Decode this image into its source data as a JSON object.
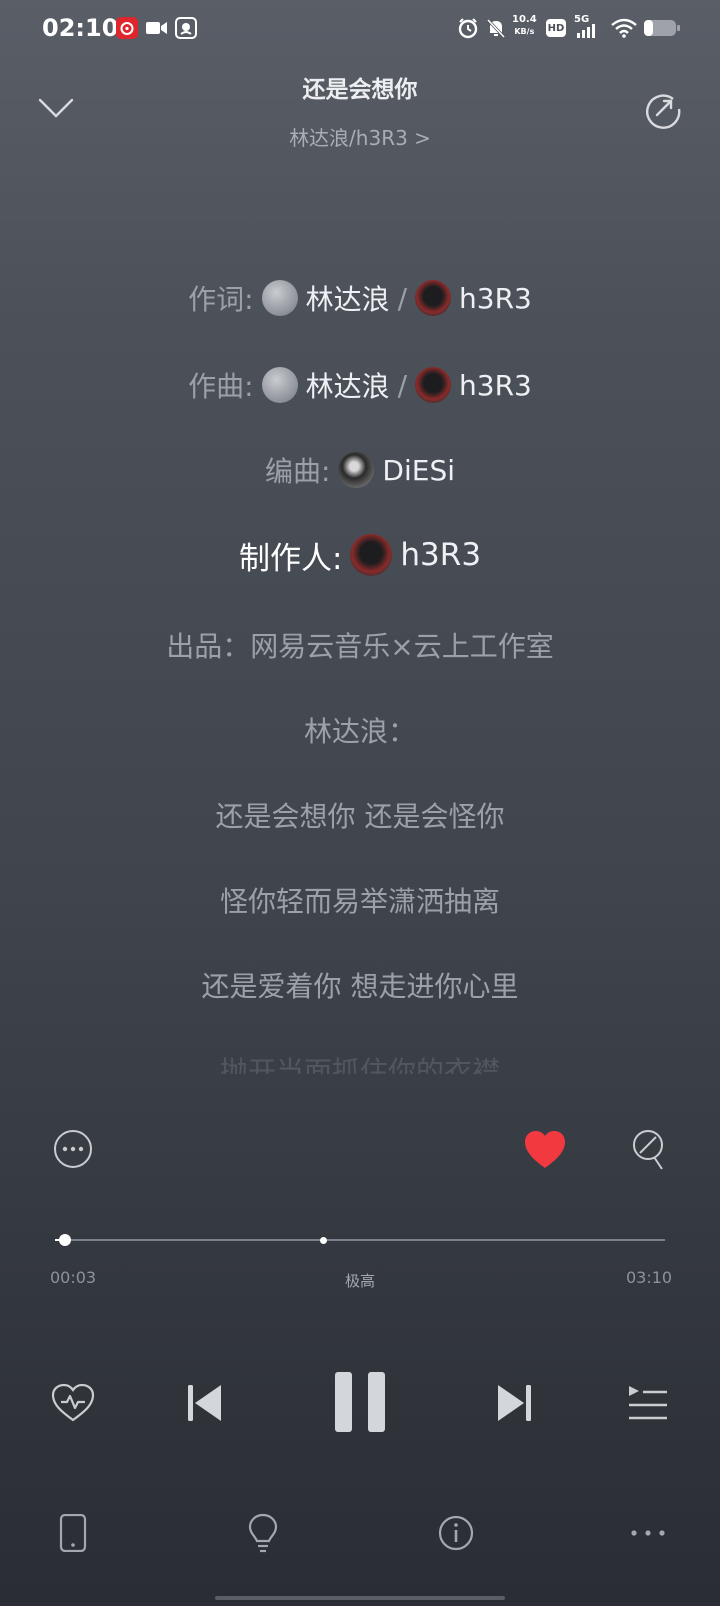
{
  "status_bar": {
    "time": "02:10",
    "net_speed_value": "10.4",
    "net_speed_unit": "KB/s",
    "hd_badge": "HD",
    "signal_label": "5G",
    "icons": [
      "netease-music-icon",
      "video-camera-icon",
      "qq-icon",
      "alarm-icon",
      "mute-bell-icon",
      "signal-icon",
      "wifi-icon",
      "battery-icon"
    ]
  },
  "header": {
    "song_title": "还是会想你",
    "artist": "林达浪/h3R3 >"
  },
  "lyrics": {
    "credits": [
      {
        "label": "作词:",
        "names": [
          "林达浪",
          "h3R3"
        ],
        "sep": "/"
      },
      {
        "label": "作曲:",
        "names": [
          "林达浪",
          "h3R3"
        ],
        "sep": "/"
      },
      {
        "label": "编曲:",
        "names": [
          "DiESi"
        ]
      },
      {
        "label": "制作人:",
        "names": [
          "h3R3"
        ]
      }
    ],
    "lines": [
      "出品：网易云音乐×云上工作室",
      "林达浪：",
      "还是会想你 还是会怪你",
      "怪你轻而易举潇洒抽离",
      "还是爱着你 想走进你心里",
      "抛开当面抓住你的衣襟"
    ]
  },
  "player": {
    "current_time": "00:03",
    "total_time": "03:10",
    "quality": "极高",
    "progress_fraction": 0.016,
    "buffer_fraction": 0.44,
    "liked": true,
    "accent_color": "#f2393f"
  }
}
